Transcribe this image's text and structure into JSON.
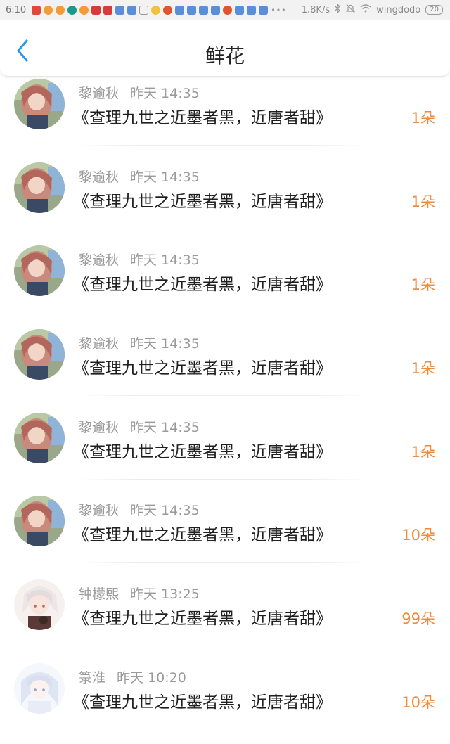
{
  "status_bar": {
    "time": "6:10",
    "net_speed": "1.8K/s",
    "wifi_name": "wingdodo",
    "battery": "20"
  },
  "header": {
    "title": "鲜花"
  },
  "items": [
    {
      "name": "黎逾秋",
      "time": "昨天 14:35",
      "message": "《查理九世之近墨者黑，近唐者甜》",
      "count": "1朵"
    },
    {
      "name": "黎逾秋",
      "time": "昨天 14:35",
      "message": "《查理九世之近墨者黑，近唐者甜》",
      "count": "1朵"
    },
    {
      "name": "黎逾秋",
      "time": "昨天 14:35",
      "message": "《查理九世之近墨者黑，近唐者甜》",
      "count": "1朵"
    },
    {
      "name": "黎逾秋",
      "time": "昨天 14:35",
      "message": "《查理九世之近墨者黑，近唐者甜》",
      "count": "1朵"
    },
    {
      "name": "黎逾秋",
      "time": "昨天 14:35",
      "message": "《查理九世之近墨者黑，近唐者甜》",
      "count": "1朵"
    },
    {
      "name": "黎逾秋",
      "time": "昨天 14:35",
      "message": "《查理九世之近墨者黑，近唐者甜》",
      "count": "10朵"
    },
    {
      "name": "钟檬熙",
      "time": "昨天 13:25",
      "message": "《查理九世之近墨者黑，近唐者甜》",
      "count": "99朵"
    },
    {
      "name": "箓淮",
      "time": "昨天 10:20",
      "message": "《查理九世之近墨者黑，近唐者甜》",
      "count": "10朵"
    }
  ],
  "colors": {
    "accent": "#2f9be8",
    "count": "#f08a3c"
  }
}
